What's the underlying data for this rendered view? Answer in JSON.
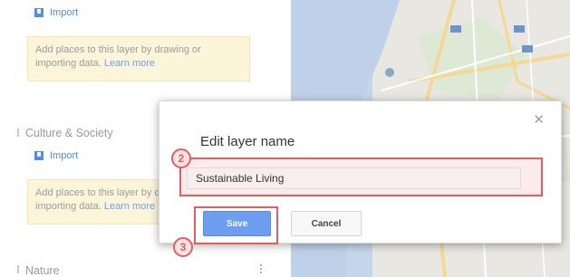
{
  "panel": {
    "top_import_label": "Import",
    "top_hint": {
      "text": "Add places to this layer by drawing or importing data. ",
      "link": "Learn more"
    },
    "layers": [
      {
        "title": "Culture & Society",
        "import_label": "Import",
        "hint_text": "Add places to this layer by drawing or importing data. ",
        "hint_link": "Learn more"
      },
      {
        "title": "Nature"
      }
    ]
  },
  "dialog": {
    "title": "Edit layer name",
    "close_icon": "close-icon",
    "name_value": "Sustainable Living",
    "save_label": "Save",
    "cancel_label": "Cancel"
  },
  "steps": {
    "name_step": "2",
    "save_step": "3"
  },
  "colors": {
    "accent": "#4d8ef0",
    "save_button": "#6f9df2",
    "highlight": "#e15f63",
    "hint_bg": "#fdf5da",
    "map_bg": "#e8e6e0"
  }
}
